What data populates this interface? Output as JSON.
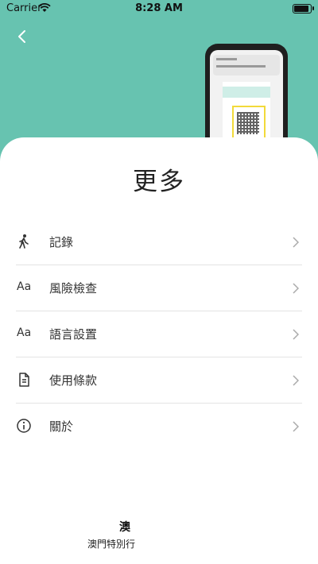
{
  "status": {
    "carrier": "Carrier",
    "time": "8:28 AM"
  },
  "colors": {
    "header_bg": "#67c3b0",
    "sheet_bg": "#ffffff",
    "text": "#333333"
  },
  "page": {
    "title": "更多"
  },
  "menu": {
    "items": [
      {
        "label": "記錄",
        "icon": "walking-person-icon"
      },
      {
        "label": "風險檢查",
        "icon": "text-aa-icon",
        "icon_text": "Aa"
      },
      {
        "label": "語言設置",
        "icon": "text-aa-icon",
        "icon_text": "Aa"
      },
      {
        "label": "使用條款",
        "icon": "document-icon"
      },
      {
        "label": "關於",
        "icon": "info-icon"
      }
    ]
  },
  "footer": {
    "line1": "澳",
    "line2": "澳門特別行"
  }
}
